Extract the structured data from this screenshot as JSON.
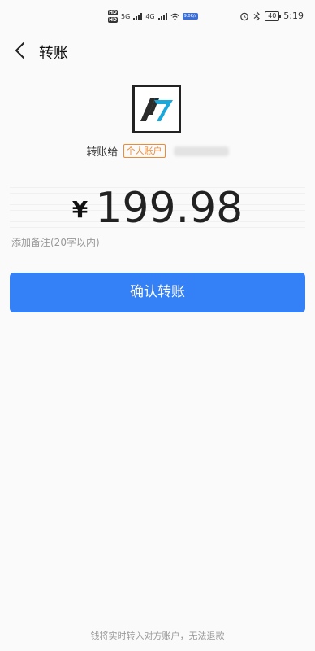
{
  "status_bar": {
    "hd1": "HD",
    "hd2": "HD",
    "net1": "5G",
    "net2": "4G",
    "wifi_label": "6",
    "speed": "9.0K/s",
    "battery": "40",
    "time": "5:19"
  },
  "header": {
    "title": "转账"
  },
  "recipient": {
    "label": "转账给",
    "account_tag": "个人账户"
  },
  "amount": {
    "currency": "¥",
    "value": "199.98"
  },
  "remark": {
    "placeholder": "添加备注(20字以内)"
  },
  "confirm": {
    "label": "确认转账"
  },
  "footer": {
    "note": "钱将实时转入对方账户，无法退款"
  },
  "colors": {
    "primary": "#3480f7",
    "tag": "#ec8b35",
    "logo_accent": "#1aa7d9"
  },
  "icons": {
    "back": "chevron-left-icon",
    "alarm": "alarm-icon",
    "bluetooth": "bluetooth-icon",
    "wifi": "wifi-icon"
  }
}
